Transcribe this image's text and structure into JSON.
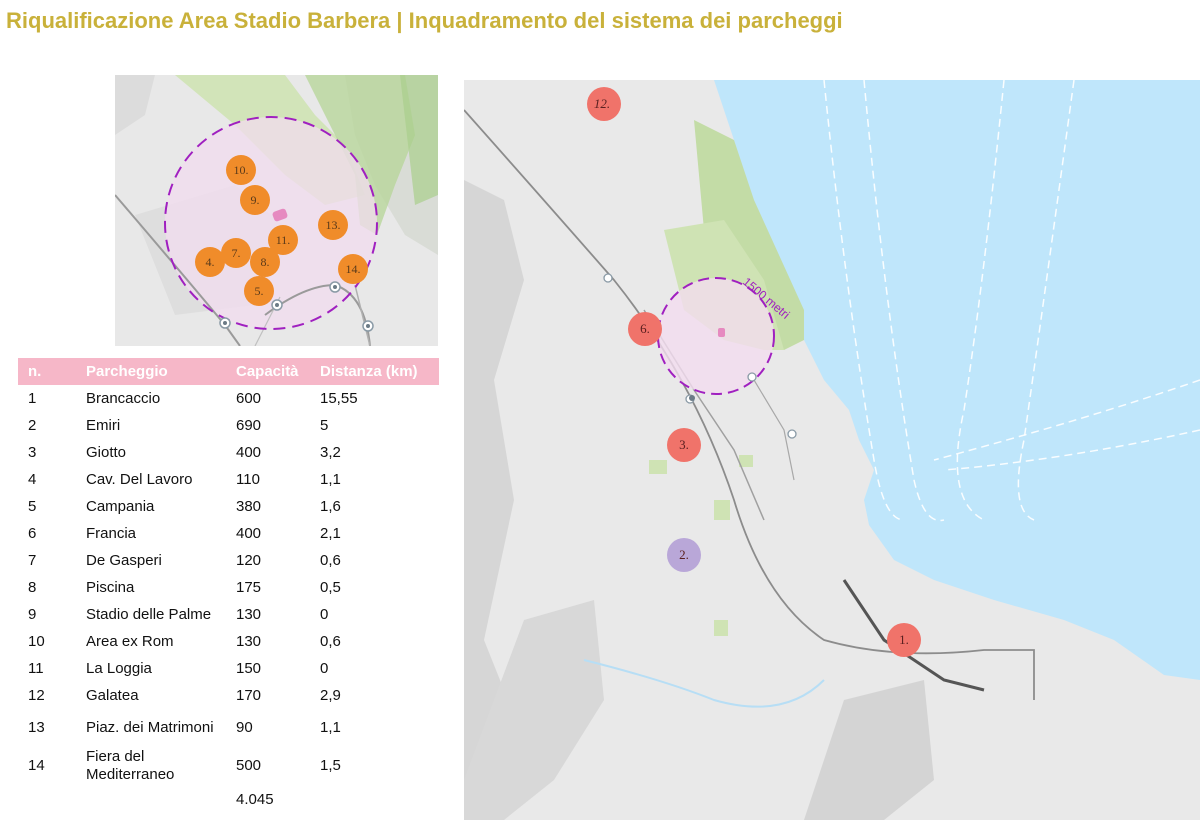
{
  "title": "Riqualificazione Area Stadio Barbera | Inquadramento del sistema dei parcheggi",
  "colors": {
    "title": "#c9b13a",
    "table_header": "#f6b7c8",
    "marker_inset": "#f08c2a",
    "marker_main": "#f0736a",
    "marker_purple": "#b9a7d8",
    "buffer_circle": "#a020c0",
    "sea": "#bfe6fb",
    "land": "#e9e9e9",
    "green": "#cfe3b4"
  },
  "table": {
    "headers": [
      "n.",
      "Parcheggio",
      "Capacità",
      "Distanza (km)"
    ],
    "rows": [
      {
        "n": "1",
        "name": "Brancaccio",
        "cap": "600",
        "dist": "15,55"
      },
      {
        "n": "2",
        "name": "Emiri",
        "cap": "690",
        "dist": "5"
      },
      {
        "n": "3",
        "name": "Giotto",
        "cap": "400",
        "dist": "3,2"
      },
      {
        "n": "4",
        "name": "Cav. Del Lavoro",
        "cap": "110",
        "dist": "1,1"
      },
      {
        "n": "5",
        "name": "Campania",
        "cap": "380",
        "dist": "1,6"
      },
      {
        "n": "6",
        "name": "Francia",
        "cap": "400",
        "dist": "2,1"
      },
      {
        "n": "7",
        "name": "De Gasperi",
        "cap": "120",
        "dist": "0,6"
      },
      {
        "n": "8",
        "name": "Piscina",
        "cap": "175",
        "dist": "0,5"
      },
      {
        "n": "9",
        "name": "Stadio delle Palme",
        "cap": "130",
        "dist": "0"
      },
      {
        "n": "10",
        "name": "Area ex Rom",
        "cap": "130",
        "dist": "0,6"
      },
      {
        "n": "11",
        "name": "La Loggia",
        "cap": "150",
        "dist": "0"
      },
      {
        "n": "12",
        "name": "Galatea",
        "cap": "170",
        "dist": "2,9"
      },
      {
        "n": "13",
        "name": "Piaz. dei Matrimoni",
        "cap": "90",
        "dist": "1,1"
      },
      {
        "n": "14",
        "name": "Fiera del Mediterraneo",
        "cap": "500",
        "dist": "1,5"
      }
    ],
    "total": "4.045"
  },
  "inset_markers": [
    "10.",
    "9.",
    "13.",
    "11.",
    "7.",
    "4.",
    "8.",
    "14.",
    "5."
  ],
  "main_markers": [
    "12.",
    "6.",
    "3.",
    "2.",
    "1."
  ],
  "radius_label": "1500 metri",
  "icons": {
    "station": "train-station-icon",
    "bus": "bus-stop-icon"
  }
}
